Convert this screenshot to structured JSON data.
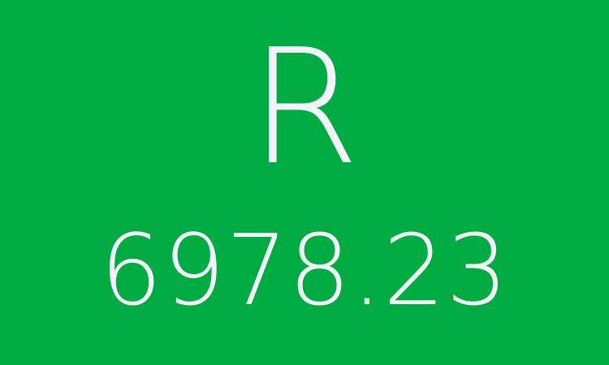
{
  "tile": {
    "currency_symbol": "R",
    "amount": "6978.23",
    "background_color": "#00ac41",
    "text_color": "#f3f4fb"
  }
}
